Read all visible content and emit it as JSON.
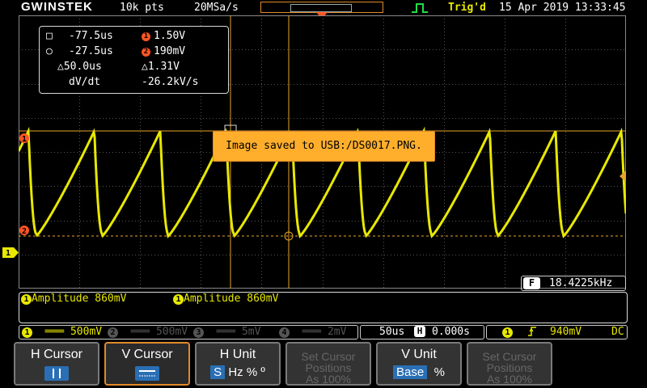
{
  "header": {
    "brand": "GWINSTEK",
    "record_length": "10k pts",
    "sample_rate": "20MSa/s",
    "trigger_status": "Trig'd",
    "datetime": "15 Apr 2019 13:33:45"
  },
  "cursor_readout": {
    "row1_left": "-77.5us",
    "row1_right": "1.50V",
    "row2_left": "-27.5us",
    "row2_right": "190mV",
    "delta_time": "△50.0us",
    "delta_volt": "△1.31V",
    "slope_label": "dV/dt",
    "slope_value": "-26.2kV/s",
    "marker1": "1",
    "marker2": "2"
  },
  "toast": {
    "message": "Image saved to USB:/DS0017.PNG."
  },
  "frequency": {
    "badge": "F",
    "value": "18.4225kHz"
  },
  "measurements": [
    {
      "badge": "1",
      "label": "Amplitude 860mV"
    },
    {
      "badge": "1",
      "label": "Amplitude 860mV"
    }
  ],
  "channels": [
    {
      "num": "1",
      "scale": "500mV",
      "active": true
    },
    {
      "num": "2",
      "scale": "500mV",
      "active": false
    },
    {
      "num": "3",
      "scale": "5mV",
      "active": false
    },
    {
      "num": "4",
      "scale": "2mV",
      "active": false
    }
  ],
  "timebase": {
    "scale": "50us",
    "h_badge": "H",
    "position": "0.000s"
  },
  "trigger": {
    "source": "1",
    "level": "940mV",
    "coupling": "DC"
  },
  "cursor_markers": {
    "ch1_ground": "1",
    "h1": "1",
    "h2": "2"
  },
  "softkeys": {
    "k1_title": "H Cursor",
    "k2_title": "V Cursor",
    "k3_title": "H Unit",
    "k3_opt_s": "S",
    "k3_opt_hz": "Hz",
    "k3_opt_pct": "%",
    "k3_opt_deg": "º",
    "k4_line1": "Set Cursor",
    "k4_line2": "Positions",
    "k4_line3": "As 100%",
    "k5_title": "V Unit",
    "k5_opt_base": "Base",
    "k5_opt_pct": "%",
    "k6_line1": "Set Cursor",
    "k6_line2": "Positions",
    "k6_line3": "As 100%"
  },
  "colors": {
    "trace": "#e8e800",
    "accent": "#e08a2a",
    "cursor": "#e8a52a",
    "toast": "#ffae2c"
  },
  "waveform": {
    "shape": "sawtooth",
    "period_divisions": 1.085,
    "amplitude_V": 0.86
  }
}
